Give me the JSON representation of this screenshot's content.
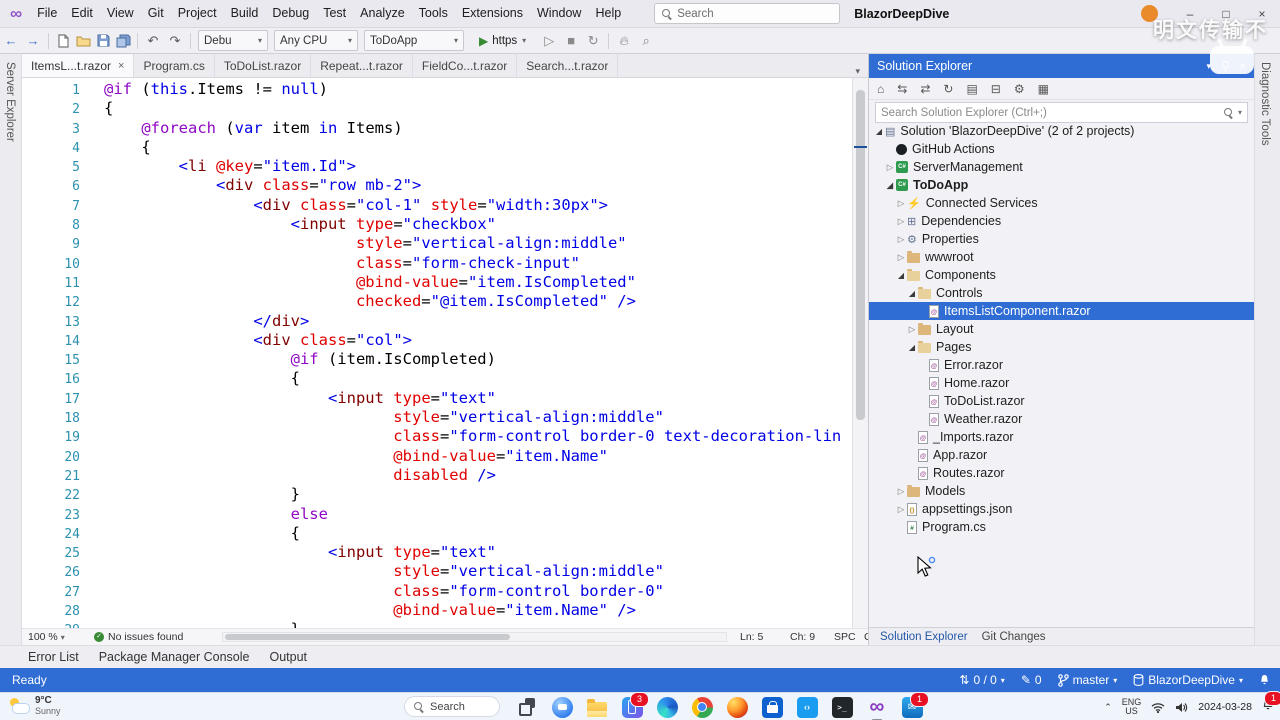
{
  "colors": {
    "accent": "#2F6CD4",
    "line_number": "#2B91AF",
    "keyword": "#0000E6",
    "control_keyword": "#8F08C4",
    "tag": "#800000",
    "attribute": "#E00000",
    "folder": "#DCB67A",
    "status_bar": "#2F6CD4"
  },
  "watermark": {
    "text": "明文传输不"
  },
  "titlebar": {
    "menus": [
      "File",
      "Edit",
      "View",
      "Git",
      "Project",
      "Build",
      "Debug",
      "Test",
      "Analyze",
      "Tools",
      "Extensions",
      "Window",
      "Help"
    ],
    "search_label": "Search",
    "solution_name": "BlazorDeepDive"
  },
  "toolbar": {
    "config": "Debu",
    "platform": "Any CPU",
    "startup_project": "ToDoApp",
    "run_label": "https"
  },
  "left_rail": [
    "Server Explorer"
  ],
  "right_rail": [
    "Diagnostic Tools"
  ],
  "editor": {
    "tabs": [
      {
        "label": "ItemsL...t.razor",
        "active": true
      },
      {
        "label": "Program.cs",
        "active": false
      },
      {
        "label": "ToDoList.razor",
        "active": false
      },
      {
        "label": "Repeat...t.razor",
        "active": false
      },
      {
        "label": "FieldCo...t.razor",
        "active": false
      },
      {
        "label": "Search...t.razor",
        "active": false
      }
    ],
    "lines": [
      [
        [
          "c",
          "@if"
        ],
        [
          "p",
          " ("
        ],
        [
          "b",
          "this"
        ],
        [
          "p",
          ".Items != "
        ],
        [
          "b",
          "null"
        ],
        [
          "p",
          ")"
        ]
      ],
      [
        [
          "p",
          "{"
        ]
      ],
      [
        [
          "p",
          "    "
        ],
        [
          "c",
          "@foreach"
        ],
        [
          "p",
          " ("
        ],
        [
          "b",
          "var"
        ],
        [
          "p",
          " item "
        ],
        [
          "b",
          "in"
        ],
        [
          "p",
          " Items)"
        ]
      ],
      [
        [
          "p",
          "    {"
        ]
      ],
      [
        [
          "p",
          "        "
        ],
        [
          "b",
          "<"
        ],
        [
          "t",
          "li"
        ],
        [
          "p",
          " "
        ],
        [
          "a",
          "@key"
        ],
        [
          "p",
          "="
        ],
        [
          "b",
          "\"item.Id\">"
        ]
      ],
      [
        [
          "p",
          "            "
        ],
        [
          "b",
          "<"
        ],
        [
          "t",
          "div"
        ],
        [
          "p",
          " "
        ],
        [
          "a",
          "class"
        ],
        [
          "p",
          "="
        ],
        [
          "b",
          "\"row mb-2\">"
        ]
      ],
      [
        [
          "p",
          "                "
        ],
        [
          "b",
          "<"
        ],
        [
          "t",
          "div"
        ],
        [
          "p",
          " "
        ],
        [
          "a",
          "class"
        ],
        [
          "p",
          "="
        ],
        [
          "b",
          "\"col-1\""
        ],
        [
          "p",
          " "
        ],
        [
          "a",
          "style"
        ],
        [
          "p",
          "="
        ],
        [
          "b",
          "\"width:30px\">"
        ]
      ],
      [
        [
          "p",
          "                    "
        ],
        [
          "b",
          "<"
        ],
        [
          "t",
          "input"
        ],
        [
          "p",
          " "
        ],
        [
          "a",
          "type"
        ],
        [
          "p",
          "="
        ],
        [
          "b",
          "\"checkbox\""
        ]
      ],
      [
        [
          "p",
          "                           "
        ],
        [
          "a",
          "style"
        ],
        [
          "p",
          "="
        ],
        [
          "b",
          "\"vertical-align:middle\""
        ]
      ],
      [
        [
          "p",
          "                           "
        ],
        [
          "a",
          "class"
        ],
        [
          "p",
          "="
        ],
        [
          "b",
          "\"form-check-input\""
        ]
      ],
      [
        [
          "p",
          "                           "
        ],
        [
          "a",
          "@bind-value"
        ],
        [
          "p",
          "="
        ],
        [
          "b",
          "\"item.IsCompleted\""
        ]
      ],
      [
        [
          "p",
          "                           "
        ],
        [
          "a",
          "checked"
        ],
        [
          "p",
          "="
        ],
        [
          "b",
          "\"@item.IsCompleted\""
        ],
        [
          "p",
          " "
        ],
        [
          "b",
          "/>"
        ]
      ],
      [
        [
          "p",
          "                "
        ],
        [
          "b",
          "</"
        ],
        [
          "t",
          "div"
        ],
        [
          "b",
          ">"
        ]
      ],
      [
        [
          "p",
          "                "
        ],
        [
          "b",
          "<"
        ],
        [
          "t",
          "div"
        ],
        [
          "p",
          " "
        ],
        [
          "a",
          "class"
        ],
        [
          "p",
          "="
        ],
        [
          "b",
          "\"col\">"
        ]
      ],
      [
        [
          "p",
          "                    "
        ],
        [
          "c",
          "@if"
        ],
        [
          "p",
          " (item.IsCompleted)"
        ]
      ],
      [
        [
          "p",
          "                    {"
        ]
      ],
      [
        [
          "p",
          "                        "
        ],
        [
          "b",
          "<"
        ],
        [
          "t",
          "input"
        ],
        [
          "p",
          " "
        ],
        [
          "a",
          "type"
        ],
        [
          "p",
          "="
        ],
        [
          "b",
          "\"text\""
        ]
      ],
      [
        [
          "p",
          "                               "
        ],
        [
          "a",
          "style"
        ],
        [
          "p",
          "="
        ],
        [
          "b",
          "\"vertical-align:middle\""
        ]
      ],
      [
        [
          "p",
          "                               "
        ],
        [
          "a",
          "class"
        ],
        [
          "p",
          "="
        ],
        [
          "b",
          "\"form-control border-0 text-decoration-lin"
        ]
      ],
      [
        [
          "p",
          "                               "
        ],
        [
          "a",
          "@bind-value"
        ],
        [
          "p",
          "="
        ],
        [
          "b",
          "\"item.Name\""
        ]
      ],
      [
        [
          "p",
          "                               "
        ],
        [
          "a",
          "disabled"
        ],
        [
          "p",
          " "
        ],
        [
          "b",
          "/>"
        ]
      ],
      [
        [
          "p",
          "                    }"
        ]
      ],
      [
        [
          "p",
          "                    "
        ],
        [
          "c",
          "else"
        ]
      ],
      [
        [
          "p",
          "                    {"
        ]
      ],
      [
        [
          "p",
          "                        "
        ],
        [
          "b",
          "<"
        ],
        [
          "t",
          "input"
        ],
        [
          "p",
          " "
        ],
        [
          "a",
          "type"
        ],
        [
          "p",
          "="
        ],
        [
          "b",
          "\"text\""
        ]
      ],
      [
        [
          "p",
          "                               "
        ],
        [
          "a",
          "style"
        ],
        [
          "p",
          "="
        ],
        [
          "b",
          "\"vertical-align:middle\""
        ]
      ],
      [
        [
          "p",
          "                               "
        ],
        [
          "a",
          "class"
        ],
        [
          "p",
          "="
        ],
        [
          "b",
          "\"form-control border-0\""
        ]
      ],
      [
        [
          "p",
          "                               "
        ],
        [
          "a",
          "@bind-value"
        ],
        [
          "p",
          "="
        ],
        [
          "b",
          "\"item.Name\""
        ],
        [
          "p",
          " "
        ],
        [
          "b",
          "/>"
        ]
      ],
      [
        [
          "p",
          "                    }"
        ]
      ]
    ],
    "status": {
      "zoom": "100 %",
      "issues": "No issues found",
      "line": "Ln: 5",
      "column": "Ch: 9",
      "spaces": "SPC",
      "eol": "CRLF"
    }
  },
  "solution_explorer": {
    "title": "Solution Explorer",
    "toolbar_icons": [
      "home",
      "switch-view",
      "sync-with-active-document",
      "refresh",
      "nest-files",
      "collapse-all",
      "properties",
      "preview"
    ],
    "search_placeholder": "Search Solution Explorer (Ctrl+;)",
    "tree": [
      {
        "label": "Solution 'BlazorDeepDive' (2 of 2 projects)",
        "indent": 0,
        "icon": "solution",
        "arrow": "expanded"
      },
      {
        "label": "GitHub Actions",
        "indent": 1,
        "icon": "github",
        "arrow": "none"
      },
      {
        "label": "ServerManagement",
        "indent": 1,
        "icon": "project",
        "arrow": "collapsed"
      },
      {
        "label": "ToDoApp",
        "indent": 1,
        "icon": "project",
        "arrow": "expanded",
        "bold": true
      },
      {
        "label": "Connected Services",
        "indent": 2,
        "icon": "services",
        "arrow": "collapsed"
      },
      {
        "label": "Dependencies",
        "indent": 2,
        "icon": "dependencies",
        "arrow": "collapsed"
      },
      {
        "label": "Properties",
        "indent": 2,
        "icon": "properties",
        "arrow": "collapsed"
      },
      {
        "label": "wwwroot",
        "indent": 2,
        "icon": "folder",
        "arrow": "collapsed"
      },
      {
        "label": "Components",
        "indent": 2,
        "icon": "folder-open",
        "arrow": "expanded"
      },
      {
        "label": "Controls",
        "indent": 3,
        "icon": "folder-open",
        "arrow": "expanded"
      },
      {
        "label": "ItemsListComponent.razor",
        "indent": 4,
        "icon": "razor",
        "arrow": "none",
        "selected": true
      },
      {
        "label": "Layout",
        "indent": 3,
        "icon": "folder",
        "arrow": "collapsed"
      },
      {
        "label": "Pages",
        "indent": 3,
        "icon": "folder-open",
        "arrow": "expanded"
      },
      {
        "label": "Error.razor",
        "indent": 4,
        "icon": "razor",
        "arrow": "none"
      },
      {
        "label": "Home.razor",
        "indent": 4,
        "icon": "razor",
        "arrow": "none"
      },
      {
        "label": "ToDoList.razor",
        "indent": 4,
        "icon": "razor",
        "arrow": "none"
      },
      {
        "label": "Weather.razor",
        "indent": 4,
        "icon": "razor",
        "arrow": "none"
      },
      {
        "label": "_Imports.razor",
        "indent": 3,
        "icon": "razor",
        "arrow": "none"
      },
      {
        "label": "App.razor",
        "indent": 3,
        "icon": "razor",
        "arrow": "none"
      },
      {
        "label": "Routes.razor",
        "indent": 3,
        "icon": "razor",
        "arrow": "none"
      },
      {
        "label": "Models",
        "indent": 2,
        "icon": "folder",
        "arrow": "collapsed"
      },
      {
        "label": "appsettings.json",
        "indent": 2,
        "icon": "json",
        "arrow": "collapsed"
      },
      {
        "label": "Program.cs",
        "indent": 2,
        "icon": "cs",
        "arrow": "none"
      }
    ],
    "bottom_tabs": [
      {
        "label": "Solution Explorer",
        "active": true
      },
      {
        "label": "Git Changes",
        "active": false
      }
    ]
  },
  "bottom_panel_tabs": [
    "Error List",
    "Package Manager Console",
    "Output"
  ],
  "statusbar": {
    "ready": "Ready",
    "sync_count": "0 / 0",
    "edit_count": "0",
    "branch": "master",
    "repo": "BlazorDeepDive"
  },
  "taskbar": {
    "weather_temp": "9°C",
    "weather_desc": "Sunny",
    "search_label": "Search",
    "apps": [
      {
        "name": "task-view"
      },
      {
        "name": "chat"
      },
      {
        "name": "file-explorer"
      },
      {
        "name": "phone-link",
        "badge": "3"
      },
      {
        "name": "edge"
      },
      {
        "name": "chrome"
      },
      {
        "name": "firefox"
      },
      {
        "name": "store"
      },
      {
        "name": "vscode"
      },
      {
        "name": "terminal"
      },
      {
        "name": "visual-studio",
        "active": true
      },
      {
        "name": "mail",
        "badge": "1"
      }
    ],
    "tray": {
      "lang_line1": "ENG",
      "lang_line2": "US",
      "date": "2024-03-28",
      "bell_badge": "1"
    }
  }
}
